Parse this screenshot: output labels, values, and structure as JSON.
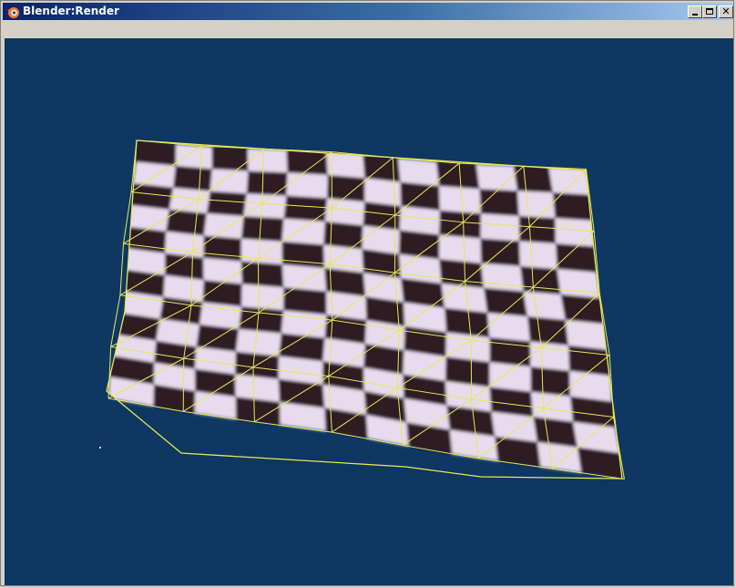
{
  "window": {
    "title": "Blender:Render",
    "controls": {
      "minimize_icon": "minimize-icon",
      "maximize_icon": "maximize-icon",
      "close_icon": "close-icon"
    }
  },
  "viewport": {
    "background_color": "#0e3762",
    "mesh_wire_color": "#e8e85a",
    "checker_dark": "#2e1d24",
    "checker_light": "#e9dbee",
    "content": "render-view"
  }
}
